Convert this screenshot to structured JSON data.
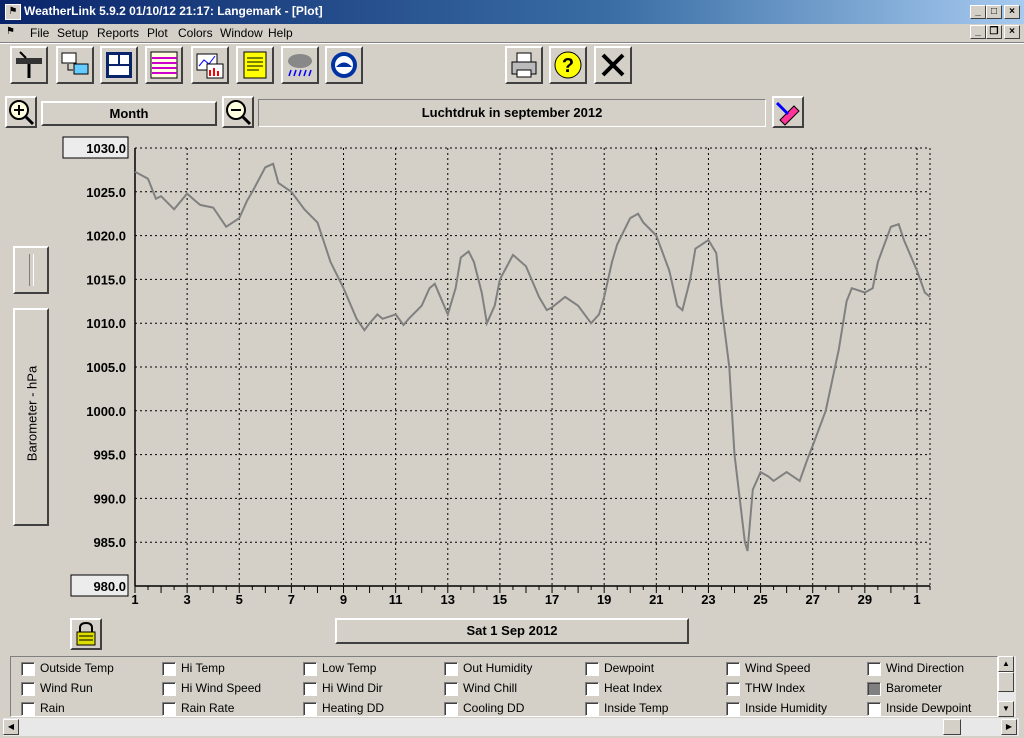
{
  "window": {
    "title": "WeatherLink 5.9.2  01/10/12  21:17: Langemark - [Plot]",
    "app_icon": "antenna-icon"
  },
  "menu": [
    "File",
    "Setup",
    "Reports",
    "Plot",
    "Colors",
    "Window",
    "Help"
  ],
  "toolbar": {
    "tools": [
      "station-select-icon",
      "download-icon",
      "bulletin-icon",
      "strip-chart-icon",
      "plot-icon",
      "notepad-icon",
      "weather-icon",
      "noaa-icon"
    ],
    "actions": [
      "print-icon",
      "help-icon",
      "close-icon"
    ]
  },
  "plot_controls": {
    "period": "Month",
    "plot_title": "Luchtdruk in september 2012",
    "date_button": "Sat 1 Sep 2012",
    "axis_panel_label": "Barometer - hPa"
  },
  "colors": {
    "line": "#808080",
    "grid": "#000000",
    "plot_bg": "#d4d0c8"
  },
  "chart_data": {
    "type": "line",
    "title": "Luchtdruk in september 2012",
    "xlabel": "",
    "ylabel": "Barometer - hPa",
    "ylim": [
      980,
      1030
    ],
    "xlim": [
      1,
      31.5
    ],
    "grid": true,
    "y_ticks": [
      "1030.0",
      "1025.0",
      "1020.0",
      "1015.0",
      "1010.0",
      "1005.0",
      "1000.0",
      "995.0",
      "990.0",
      "985.0",
      "980.0"
    ],
    "x_ticks": [
      {
        "pos": 1,
        "label": "1"
      },
      {
        "pos": 3,
        "label": "3"
      },
      {
        "pos": 5,
        "label": "5"
      },
      {
        "pos": 7,
        "label": "7"
      },
      {
        "pos": 9,
        "label": "9"
      },
      {
        "pos": 11,
        "label": "11"
      },
      {
        "pos": 13,
        "label": "13"
      },
      {
        "pos": 15,
        "label": "15"
      },
      {
        "pos": 17,
        "label": "17"
      },
      {
        "pos": 19,
        "label": "19"
      },
      {
        "pos": 21,
        "label": "21"
      },
      {
        "pos": 23,
        "label": "23"
      },
      {
        "pos": 25,
        "label": "25"
      },
      {
        "pos": 27,
        "label": "27"
      },
      {
        "pos": 29,
        "label": "29"
      },
      {
        "pos": 31,
        "label": "1"
      }
    ],
    "series": [
      {
        "x": [
          1.0,
          1.5,
          1.8,
          2.0,
          2.5,
          3.0,
          3.3,
          3.5,
          4.0,
          4.5,
          5.0,
          5.3,
          5.5,
          6.0,
          6.3,
          6.5,
          7.0,
          7.5,
          8.0,
          8.5,
          9.0,
          9.5,
          9.8,
          10.0,
          10.3,
          10.5,
          11.0,
          11.3,
          11.5,
          12.0,
          12.3,
          12.5,
          13.0,
          13.3,
          13.5,
          13.8,
          14.0,
          14.3,
          14.5,
          14.8,
          15.0,
          15.5,
          16.0,
          16.5,
          16.8,
          17.0,
          17.5,
          18.0,
          18.5,
          18.8,
          19.0,
          19.3,
          19.5,
          20.0,
          20.3,
          20.5,
          21.0,
          21.5,
          21.8,
          22.0,
          22.3,
          22.5,
          23.0,
          23.3,
          23.5,
          23.8,
          24.0,
          24.2,
          24.4,
          24.5,
          24.7,
          25.0,
          25.3,
          25.5,
          26.0,
          26.5,
          26.8,
          27.0,
          27.5,
          28.0,
          28.3,
          28.5,
          29.0,
          29.3,
          29.5,
          30.0,
          30.3,
          30.5,
          31.0,
          31.3,
          31.5
        ],
        "y": [
          1027.3,
          1026.5,
          1024.2,
          1024.5,
          1023.0,
          1024.8,
          1024.0,
          1023.5,
          1023.2,
          1021.0,
          1022.0,
          1024.0,
          1025.0,
          1027.8,
          1028.2,
          1026.0,
          1025.0,
          1023.0,
          1021.5,
          1017.0,
          1014.0,
          1010.5,
          1009.2,
          1010.0,
          1011.0,
          1010.5,
          1011.0,
          1009.8,
          1010.5,
          1012.0,
          1014.0,
          1014.5,
          1011.0,
          1014.0,
          1017.5,
          1018.2,
          1017.0,
          1013.5,
          1010.0,
          1012.0,
          1015.0,
          1017.8,
          1016.5,
          1013.0,
          1011.5,
          1011.8,
          1013.0,
          1012.0,
          1010.0,
          1011.0,
          1013.0,
          1017.0,
          1019.0,
          1022.0,
          1022.5,
          1021.5,
          1020.0,
          1016.0,
          1012.0,
          1011.5,
          1015.0,
          1018.5,
          1019.5,
          1018.0,
          1012.0,
          1005.0,
          995.0,
          990.0,
          985.0,
          984.0,
          991.0,
          993.0,
          992.5,
          992.0,
          993.0,
          992.0,
          994.5,
          996.0,
          1000.0,
          1007.0,
          1012.5,
          1014.0,
          1013.5,
          1014.0,
          1017.0,
          1021.0,
          1021.3,
          1019.5,
          1016.0,
          1013.5,
          1013.0
        ]
      }
    ]
  },
  "checkboxes": [
    {
      "label": "Outside Temp",
      "checked": false
    },
    {
      "label": "Hi Temp",
      "checked": false
    },
    {
      "label": "Low Temp",
      "checked": false
    },
    {
      "label": "Out Humidity",
      "checked": false
    },
    {
      "label": "Dewpoint",
      "checked": false
    },
    {
      "label": "Wind Speed",
      "checked": false
    },
    {
      "label": "Wind Direction",
      "checked": false
    },
    {
      "label": "Wind Run",
      "checked": false
    },
    {
      "label": "Hi Wind Speed",
      "checked": false
    },
    {
      "label": "Hi Wind Dir",
      "checked": false
    },
    {
      "label": "Wind Chill",
      "checked": false
    },
    {
      "label": "Heat Index",
      "checked": false
    },
    {
      "label": "THW Index",
      "checked": false
    },
    {
      "label": "Barometer",
      "checked": true
    },
    {
      "label": "Rain",
      "checked": false
    },
    {
      "label": "Rain Rate",
      "checked": false
    },
    {
      "label": "Heating DD",
      "checked": false
    },
    {
      "label": "Cooling DD",
      "checked": false
    },
    {
      "label": "Inside Temp",
      "checked": false
    },
    {
      "label": "Inside Humidity",
      "checked": false
    },
    {
      "label": "Inside Dewpoint",
      "checked": false
    }
  ]
}
